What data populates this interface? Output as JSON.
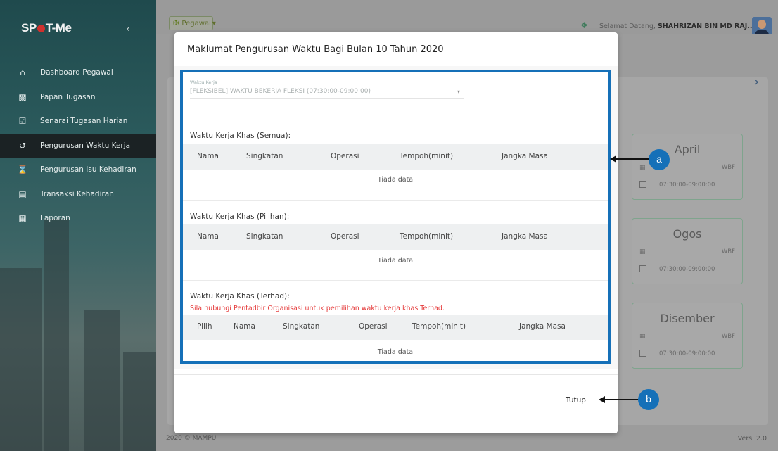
{
  "app": {
    "logo": "SP T-Me",
    "logo_left": "SP",
    "logo_right": "T-Me"
  },
  "sidebar": {
    "items": [
      {
        "label": "Dashboard Pegawai",
        "icon": "home-icon"
      },
      {
        "label": "Papan Tugasan",
        "icon": "puzzle-icon"
      },
      {
        "label": "Senarai Tugasan Harian",
        "icon": "checklist-icon"
      },
      {
        "label": "Pengurusan Waktu Kerja",
        "icon": "clock-icon",
        "active": true
      },
      {
        "label": "Pengurusan Isu Kehadiran",
        "icon": "hourglass-icon"
      },
      {
        "label": "Transaksi Kehadiran",
        "icon": "list-icon"
      },
      {
        "label": "Laporan",
        "icon": "report-icon"
      }
    ]
  },
  "topbar": {
    "role_dropdown": "Pegawai",
    "welcome_prefix": "Selamat Datang,",
    "user_name": "SHAHRIZAN BIN MD RAJ..."
  },
  "background": {
    "months": [
      {
        "name": "April",
        "code": "WBF",
        "time": "07:30:00-09:00:00"
      },
      {
        "name": "Ogos",
        "code": "WBF",
        "time": "07:30:00-09:00:00"
      },
      {
        "name": "Disember",
        "code": "WBF",
        "time": "07:30:00-09:00:00"
      }
    ],
    "footer_left": "2020 © MAMPU",
    "footer_right": "Versi 2.0"
  },
  "modal": {
    "title": "Maklumat Pengurusan Waktu Bagi Bulan 10 Tahun 2020",
    "waktu_kerja_label": "Waktu Kerja",
    "waktu_kerja_value": "[FLEKSIBEL] WAKTU BEKERJA FLEKSI (07:30:00-09:00:00)",
    "sections": [
      {
        "title": "Waktu Kerja Khas (Semua):",
        "columns": [
          "Nama",
          "Singkatan",
          "Operasi",
          "Tempoh(minit)",
          "Jangka Masa"
        ],
        "empty": "Tiada data"
      },
      {
        "title": "Waktu Kerja Khas (Pilihan):",
        "columns": [
          "Nama",
          "Singkatan",
          "Operasi",
          "Tempoh(minit)",
          "Jangka Masa"
        ],
        "empty": "Tiada data"
      },
      {
        "title": "Waktu Kerja Khas (Terhad):",
        "warning": "Sila hubungi Pentadbir Organisasi untuk pemilihan waktu kerja khas Terhad.",
        "columns": [
          "Pilih",
          "Nama",
          "Singkatan",
          "Operasi",
          "Tempoh(minit)",
          "Jangka Masa"
        ],
        "empty": "Tiada data"
      }
    ],
    "close_label": "Tutup"
  },
  "annotations": {
    "a": "a",
    "b": "b"
  },
  "colors": {
    "highlight": "#1570b8",
    "warning": "#e53b3b",
    "sidebar_active": "#1b2224"
  }
}
